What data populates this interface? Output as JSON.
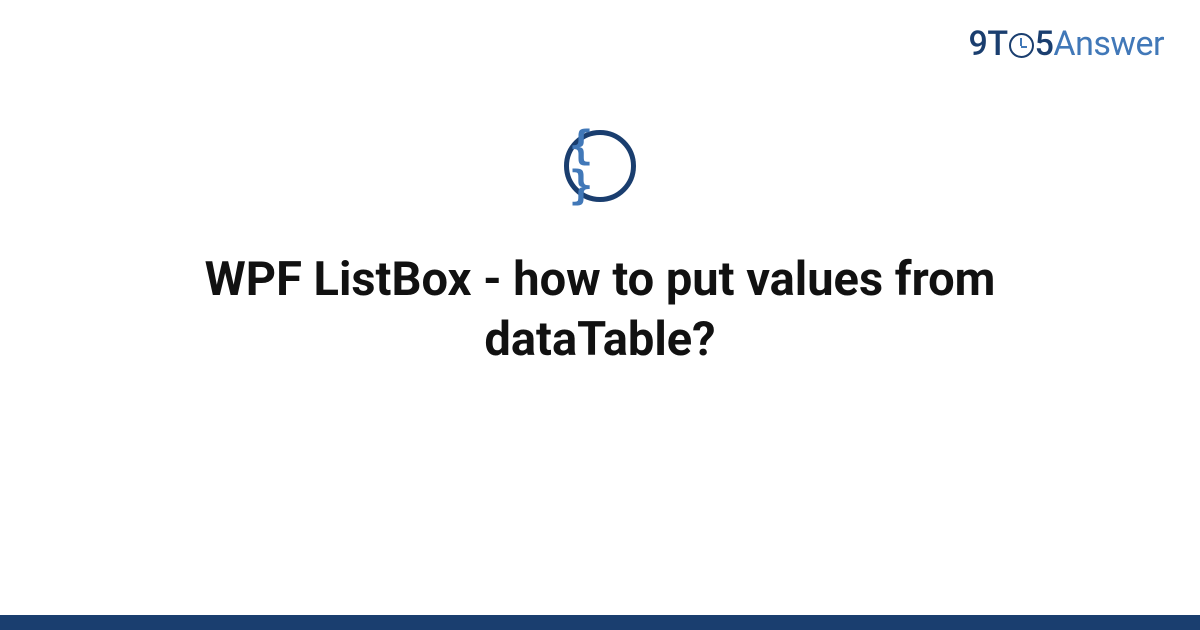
{
  "brand": {
    "part1": "9",
    "part2": "T",
    "part3": "5",
    "part4": "Answer"
  },
  "icon": {
    "glyph": "{ }",
    "name": "code-braces"
  },
  "question": {
    "title": "WPF ListBox - how to put values from dataTable?"
  }
}
